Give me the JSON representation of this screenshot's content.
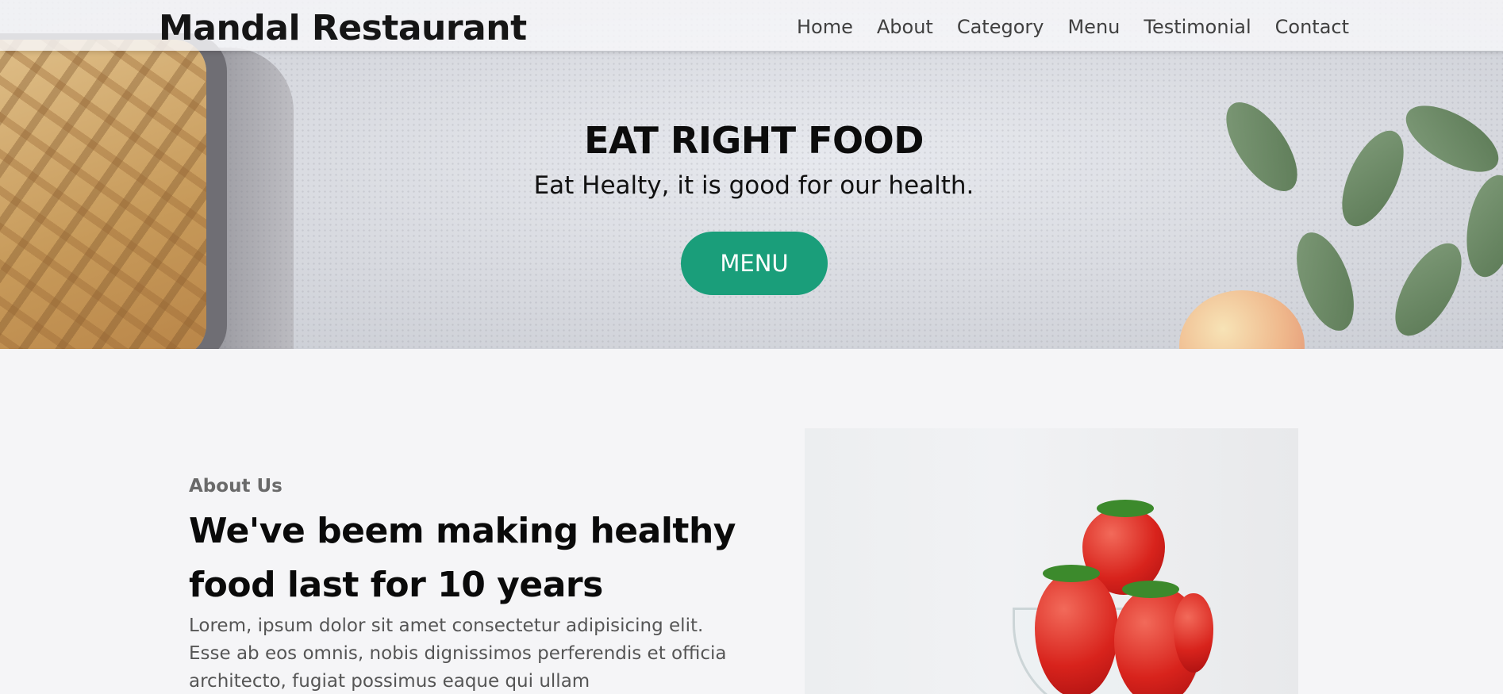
{
  "brand": "Mandal Restaurant",
  "nav": {
    "items": [
      {
        "label": "Home"
      },
      {
        "label": "About"
      },
      {
        "label": "Category"
      },
      {
        "label": "Menu"
      },
      {
        "label": "Testimonial"
      },
      {
        "label": "Contact"
      }
    ]
  },
  "hero": {
    "title": "EAT RIGHT FOOD",
    "subtitle": "Eat Healty, it is good for our health.",
    "button_label": "MENU"
  },
  "about": {
    "label": "About Us",
    "title": "We've beem making healthy food last for 10 years",
    "text": "Lorem, ipsum dolor sit amet consectetur adipisicing elit. Esse ab eos omnis, nobis dignissimos perferendis et officia architecto, fugiat possimus eaque qui ullam"
  },
  "colors": {
    "accent": "#1a9e7a",
    "page_background": "#f5f5f7",
    "heading": "#0a0a0a",
    "body_text": "#555555"
  },
  "icons": {
    "hero_background": "food-flatlay-image",
    "about_image": "strawberry-bowl-image"
  }
}
